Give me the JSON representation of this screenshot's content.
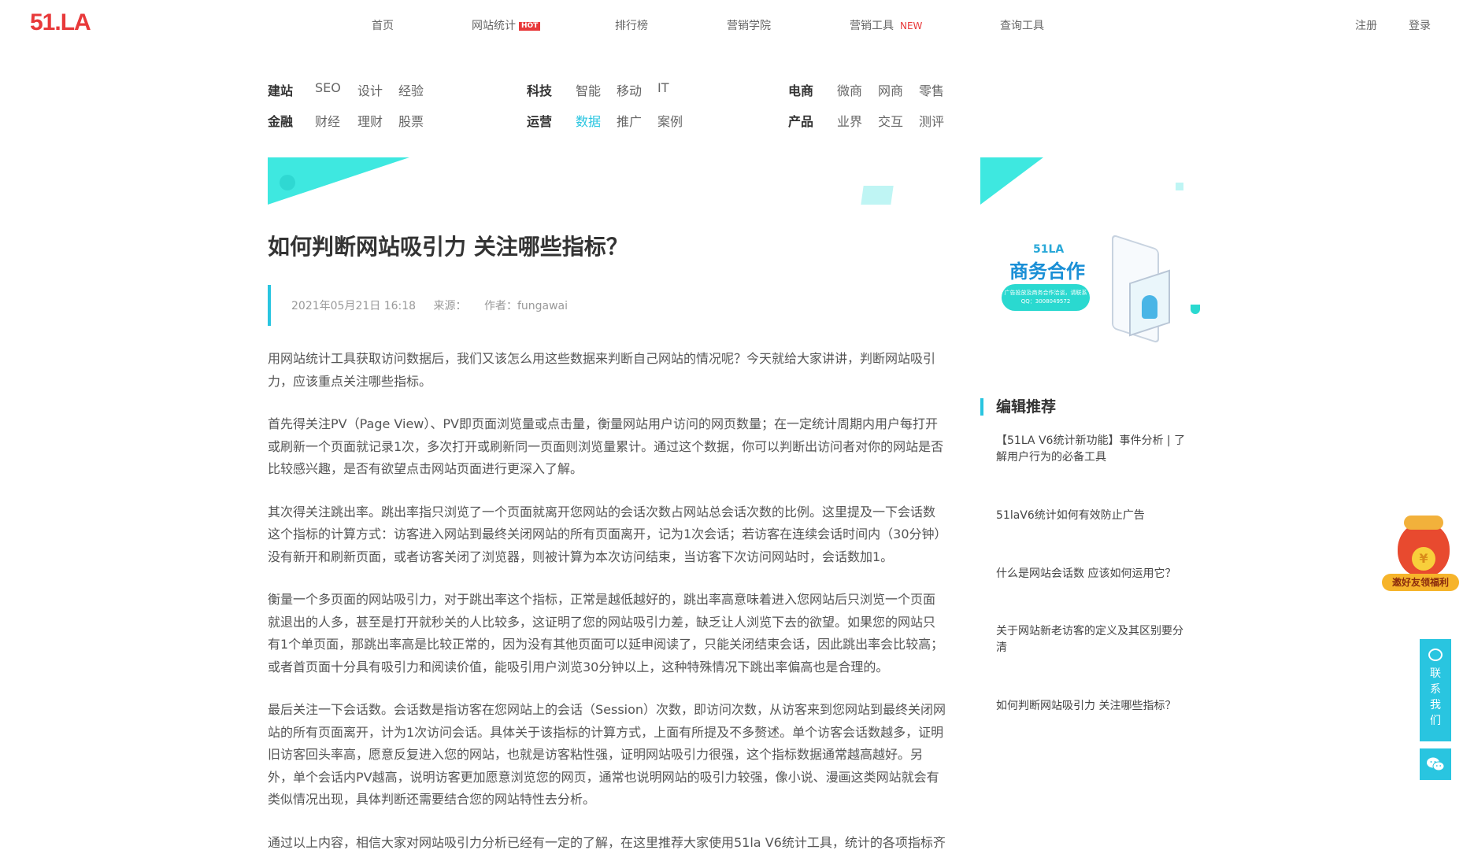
{
  "header": {
    "logo": "51.LA",
    "nav": [
      {
        "label": "首页"
      },
      {
        "label": "网站统计",
        "badge": "HOT"
      },
      {
        "label": "排行榜"
      },
      {
        "label": "营销学院"
      },
      {
        "label": "营销工具",
        "badge": "NEW"
      },
      {
        "label": "查询工具"
      }
    ],
    "register": "注册",
    "login": "登录"
  },
  "categories": [
    {
      "head": "建站",
      "links": [
        "SEO",
        "设计",
        "经验"
      ]
    },
    {
      "head": "科技",
      "links": [
        "智能",
        "移动",
        "IT"
      ]
    },
    {
      "head": "电商",
      "links": [
        "微商",
        "网商",
        "零售"
      ]
    },
    {
      "head": "金融",
      "links": [
        "财经",
        "理财",
        "股票"
      ]
    },
    {
      "head": "运营",
      "links": [
        "数据",
        "推广",
        "案例"
      ],
      "active": "数据"
    },
    {
      "head": "产品",
      "links": [
        "业界",
        "交互",
        "测评"
      ]
    }
  ],
  "article": {
    "title": "如何判断网站吸引力 关注哪些指标？",
    "date": "2021年05月21日 16:18",
    "source": "来源：",
    "author": "作者：fungawai",
    "paragraphs": [
      "用网站统计工具获取访问数据后，我们又该怎么用这些数据来判断自己网站的情况呢？今天就给大家讲讲，判断网站吸引力，应该重点关注哪些指标。",
      "首先得关注PV（Page View）、PV即页面浏览量或点击量，衡量网站用户访问的网页数量；在一定统计周期内用户每打开或刷新一个页面就记录1次，多次打开或刷新同一页面则浏览量累计。通过这个数据，你可以判断出访问者对你的网站是否比较感兴趣，是否有欲望点击网站页面进行更深入了解。",
      "其次得关注跳出率。跳出率指只浏览了一个页面就离开您网站的会话次数占网站总会话次数的比例。这里提及一下会话数这个指标的计算方式：访客进入网站到最终关闭网站的所有页面离开，记为1次会话；若访客在连续会话时间内（30分钟）没有新开和刷新页面，或者访客关闭了浏览器，则被计算为本次访问结束，当访客下次访问网站时，会话数加1。",
      "衡量一个多页面的网站吸引力，对于跳出率这个指标，正常是越低越好的，跳出率高意味着进入您网站后只浏览一个页面就退出的人多，甚至是打开就秒关的人比较多，这证明了您的网站吸引力差，缺乏让人浏览下去的欲望。如果您的网站只有1个单页面，那跳出率高是比较正常的，因为没有其他页面可以延申阅读了，只能关闭结束会话，因此跳出率会比较高；或者首页面十分具有吸引力和阅读价值，能吸引用户浏览30分钟以上，这种特殊情况下跳出率偏高也是合理的。",
      "最后关注一下会话数。会话数是指访客在您网站上的会话（Session）次数，即访问次数，从访客来到您网站到最终关闭网站的所有页面离开，计为1次访问会话。具体关于该指标的计算方式，上面有所提及不多赘述。单个访客会话数越多，证明旧访客回头率高，愿意反复进入您的网站，也就是访客粘性强，证明网站吸引力很强，这个指标数据通常越高越好。另外，单个会话内PV越高，说明访客更加愿意浏览您的网页，通常也说明网站的吸引力较强，像小说、漫画这类网站就会有类似情况出现，具体判断还需要结合您的网站特性去分析。",
      "通过以上内容，相信大家对网站吸引力分析已经有一定的了解，在这里推荐大家使用51la V6统计工具，统计的各项指标齐"
    ]
  },
  "sidebar": {
    "promo": {
      "brand": "51LA",
      "title": "商务合作",
      "pill_line1": "广告投放及商务合作洽谈，请联系",
      "pill_line2": "QQ：3008049572"
    },
    "section_title": "编辑推荐",
    "recommendations": [
      "【51LA V6统计新功能】事件分析 | 了解用户行为的必备工具",
      "51laV6统计如何有效防止广告",
      "什么是网站会话数 应该如何运用它？",
      "关于网站新老访客的定义及其区别要分清",
      "如何判断网站吸引力 关注哪些指标？"
    ]
  },
  "float": {
    "bag_label": "邀好友领福利",
    "coin": "¥",
    "contact": [
      "联",
      "系",
      "我",
      "们"
    ]
  },
  "colors": {
    "accent": "#29c5e0",
    "brand_red": "#e8393a",
    "banner_cyan": "#3ee8e0"
  }
}
